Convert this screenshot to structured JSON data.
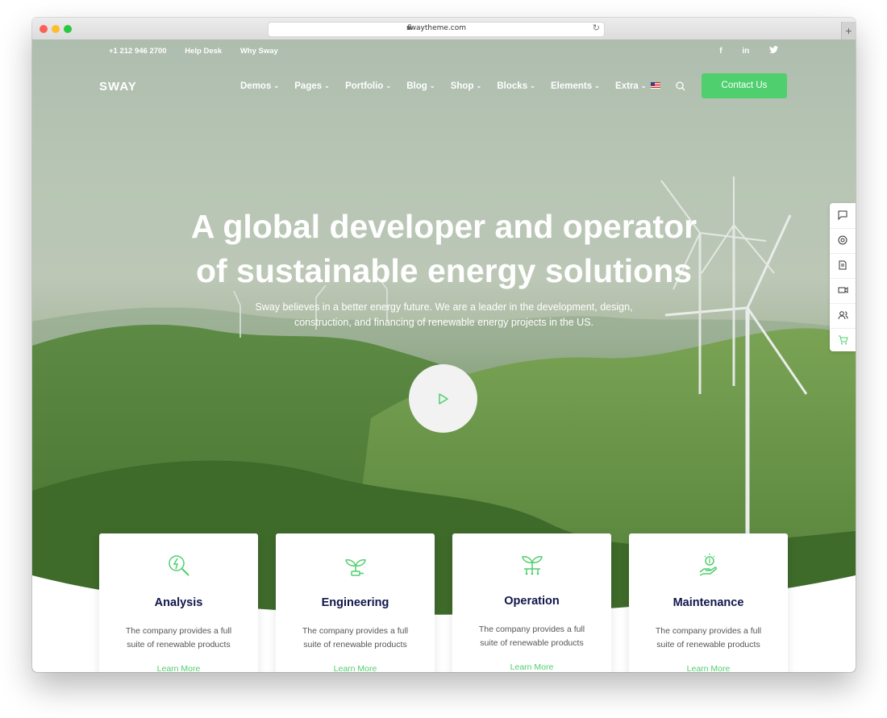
{
  "browser": {
    "url": "swaytheme.com"
  },
  "topbar": {
    "phone": "+1 212 946 2700",
    "help": "Help Desk",
    "why": "Why Sway"
  },
  "social": [
    "facebook-icon",
    "linkedin-icon",
    "twitter-icon"
  ],
  "header": {
    "logo": "SWAY",
    "nav": [
      "Demos",
      "Pages",
      "Portfolio",
      "Blog",
      "Shop",
      "Blocks",
      "Elements",
      "Extra"
    ],
    "contact": "Contact Us"
  },
  "hero": {
    "title_line1": "A global developer and operator",
    "title_line2": "of sustainable energy solutions",
    "sub_line1": "Sway believes in a better energy future. We are a leader in the development, design,",
    "sub_line2": "construction, and financing of renewable energy projects in the US."
  },
  "sidetools": [
    "chat-icon",
    "support-icon",
    "document-icon",
    "video-icon",
    "users-icon",
    "cart-icon"
  ],
  "cards": [
    {
      "title": "Analysis",
      "line1": "The company provides a full",
      "line2": "suite of renewable products",
      "more": "Learn More",
      "icon": "magnifier-energy-icon"
    },
    {
      "title": "Engineering",
      "line1": "The company provides a full",
      "line2": "suite of renewable products",
      "more": "Learn More",
      "icon": "plant-plug-icon"
    },
    {
      "title": "Operation",
      "line1": "The company provides a full",
      "line2": "suite of renewable products",
      "more": "Learn More",
      "icon": "plant-circuit-icon"
    },
    {
      "title": "Maintenance",
      "line1": "The company provides a full",
      "line2": "suite of renewable products",
      "more": "Learn More",
      "icon": "hand-coin-icon"
    }
  ],
  "colors": {
    "accent": "#4fcf6e",
    "heading": "#10164a"
  }
}
